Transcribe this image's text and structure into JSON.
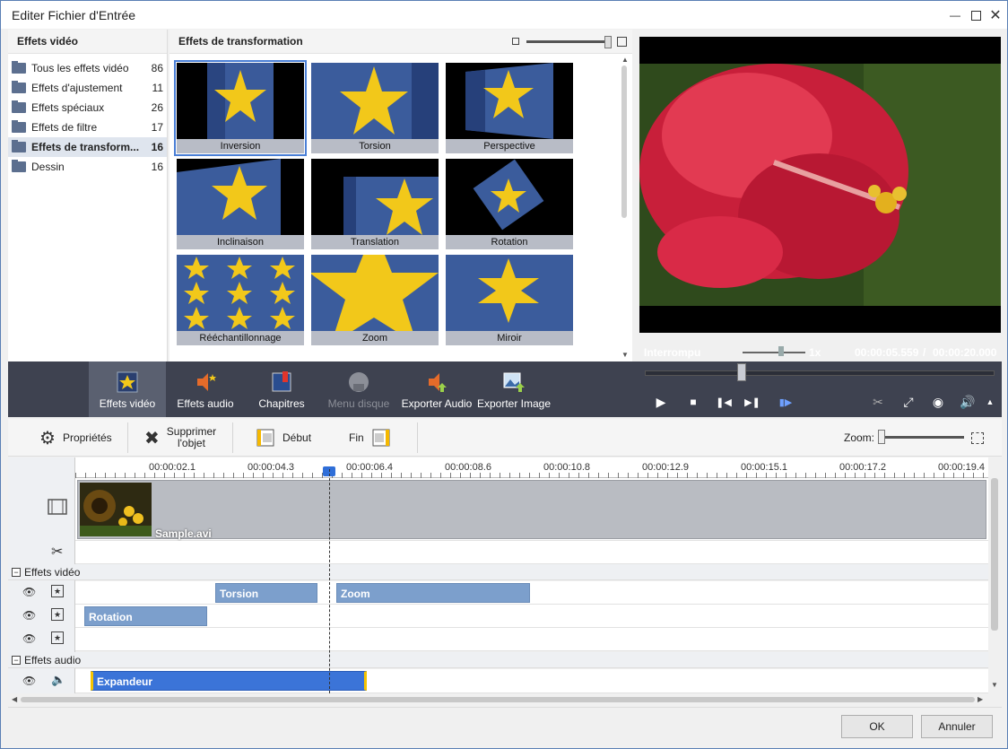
{
  "window": {
    "title": "Editer Fichier d'Entrée"
  },
  "categories": {
    "header": "Effets vidéo",
    "items": [
      {
        "label": "Tous les effets vidéo",
        "count": "86"
      },
      {
        "label": "Effets d'ajustement",
        "count": "11"
      },
      {
        "label": "Effets spéciaux",
        "count": "26"
      },
      {
        "label": "Effets de filtre",
        "count": "17"
      },
      {
        "label": "Effets de transform...",
        "count": "16"
      },
      {
        "label": "Dessin",
        "count": "16"
      }
    ]
  },
  "effects_grid": {
    "header": "Effets de transformation",
    "tiles": [
      "Inversion",
      "Torsion",
      "Perspective",
      "Inclinaison",
      "Translation",
      "Rotation",
      "Rééchantillonnage",
      "Zoom",
      "Miroir"
    ]
  },
  "preview": {
    "status": "Interrompu",
    "speed": "1x",
    "current_time": "00:00:05.559",
    "separator": "/",
    "total_time": "00:00:20.000"
  },
  "tabs": [
    "Effets vidéo",
    "Effets audio",
    "Chapitres",
    "Menu disque",
    "Exporter Audio",
    "Exporter Image"
  ],
  "toolbar": {
    "properties": "Propriétés",
    "delete_line1": "Supprimer",
    "delete_line2": "l'objet",
    "start": "Début",
    "end": "Fin",
    "zoom": "Zoom:"
  },
  "ruler": [
    "00:00:02.1",
    "00:00:04.3",
    "00:00:06.4",
    "00:00:08.6",
    "00:00:10.8",
    "00:00:12.9",
    "00:00:15.1",
    "00:00:17.2",
    "00:00:19.4"
  ],
  "timeline": {
    "video_clip": "Sample.avi",
    "video_effects_header": "Effets vidéo",
    "audio_effects_header": "Effets audio",
    "clips": {
      "torsion": "Torsion",
      "zoom": "Zoom",
      "rotation": "Rotation",
      "expandeur": "Expandeur"
    }
  },
  "footer": {
    "ok": "OK",
    "cancel": "Annuler"
  }
}
